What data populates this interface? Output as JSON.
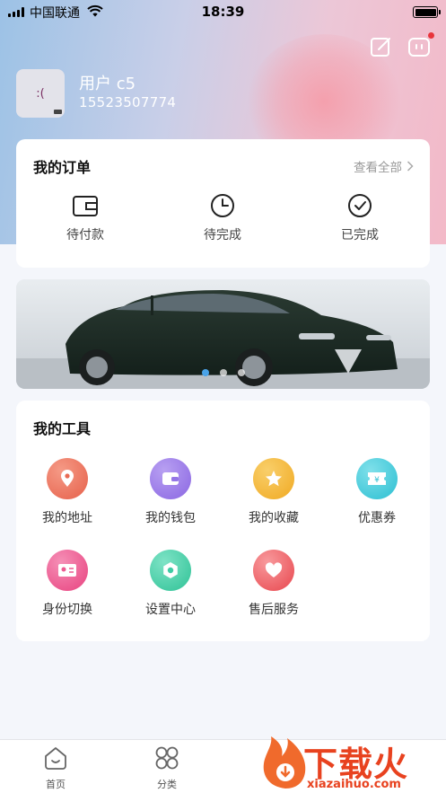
{
  "status_bar": {
    "carrier": "中国联通",
    "time": "18:39"
  },
  "profile": {
    "avatar_text": ":(",
    "username": "用户 c5",
    "phone": "15523507774"
  },
  "orders": {
    "title": "我的订单",
    "view_all": "查看全部",
    "items": [
      {
        "label": "待付款",
        "icon": "wallet-icon"
      },
      {
        "label": "待完成",
        "icon": "clock-icon"
      },
      {
        "label": "已完成",
        "icon": "check-circle-icon"
      }
    ]
  },
  "banner": {
    "slides": 3,
    "active_slide": 1
  },
  "tools": {
    "title": "我的工具",
    "items": [
      {
        "label": "我的地址",
        "icon": "location-icon",
        "color": "#ec6f5a"
      },
      {
        "label": "我的钱包",
        "icon": "wallet-icon",
        "color": "#9b7be8"
      },
      {
        "label": "我的收藏",
        "icon": "star-icon",
        "color": "#f4b73a"
      },
      {
        "label": "优惠券",
        "icon": "coupon-icon",
        "color": "#3ec9d8"
      },
      {
        "label": "身份切换",
        "icon": "id-card-icon",
        "color": "#ef5b92"
      },
      {
        "label": "设置中心",
        "icon": "settings-icon",
        "color": "#3ecba3"
      },
      {
        "label": "售后服务",
        "icon": "heart-icon",
        "color": "#f0646a"
      }
    ]
  },
  "tabbar": {
    "items": [
      {
        "label": "首页",
        "icon": "home-icon"
      },
      {
        "label": "分类",
        "icon": "category-icon"
      }
    ]
  },
  "watermark": {
    "text": "下载火",
    "url": "xiazaihuo.com"
  }
}
